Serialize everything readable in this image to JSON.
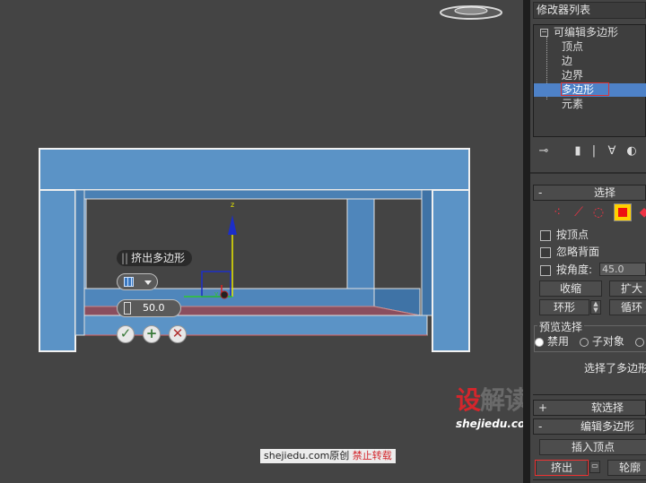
{
  "viewport": {
    "caddy_title": "挤出多边形",
    "height_value": "50.0"
  },
  "watermark": {
    "brand_red": "设",
    "brand_gray": "解读",
    "url": "shejiedu.com",
    "bar_main": "shejiedu.com原创",
    "bar_red": "禁止转载"
  },
  "panel": {
    "modifier_list": "修改器列表",
    "stack_root": "可编辑多边形",
    "stack_items": [
      "顶点",
      "边",
      "边界",
      "多边形",
      "元素"
    ],
    "selected_item": "多边形",
    "selection_rollout": "选择",
    "by_vertex": "按顶点",
    "ignore_backfacing": "忽略背面",
    "by_angle": "按角度:",
    "angle_value": "45.0",
    "shrink": "收缩",
    "grow": "扩大",
    "ring": "环形",
    "loop": "循环",
    "preview_selection": "预览选择",
    "disabled": "禁用",
    "subobject": "子对象",
    "status": "选择了多边形",
    "soft_selection": "软选择",
    "edit_polygons": "编辑多边形",
    "insert_vertex": "插入顶点",
    "extrude": "挤出",
    "outline": "轮廓"
  },
  "colors": {
    "viewport_bg": "#444444",
    "object_blue": "#5b93c6",
    "selected_face": "#8a4e5e",
    "highlight_blue": "#4e82c8",
    "accent_red": "#d3262c"
  }
}
